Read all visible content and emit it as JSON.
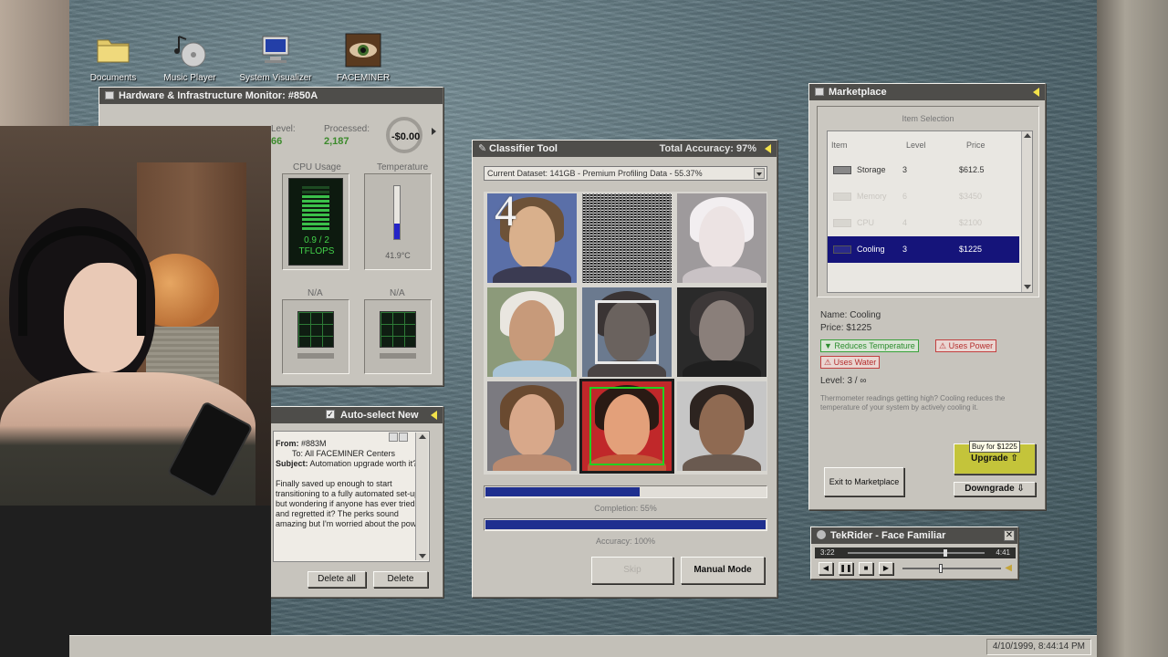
{
  "desktop_icons": [
    {
      "label": "Documents",
      "icon": "folder-icon"
    },
    {
      "label": "Music Player",
      "icon": "music-player-icon"
    },
    {
      "label": "System Visualizer",
      "icon": "monitor-icon"
    },
    {
      "label": "FACEMINER",
      "icon": "eye-icon"
    }
  ],
  "hardware": {
    "title": "Hardware & Infrastructure Monitor: #850A",
    "level_label": "Level:",
    "level_value": "66",
    "processed_label": "Processed:",
    "processed_value": "2,187",
    "money": "-$0.00",
    "cpu_label": "CPU Usage",
    "cpu_value": "0.9 / 2",
    "cpu_unit": "TFLOPS",
    "cpu_fraction": 0.45,
    "temp_label": "Temperature",
    "temp_value": "41.9°C",
    "temp_fraction": 0.3,
    "slot1_label": "N/A",
    "slot2_label": "N/A"
  },
  "classifier": {
    "title": "Classifier Tool",
    "accuracy_header": "Total Accuracy: 97%",
    "dataset": "Current Dataset: 141GB - Premium Profiling Data - 55.37%",
    "overlay_number": "4",
    "completion_label": "Completion: 55%",
    "completion_fraction": 0.55,
    "accuracy_label": "Accuracy: 100%",
    "accuracy_fraction": 1.0,
    "skip_label": "Skip",
    "manual_label": "Manual Mode"
  },
  "email": {
    "title": "Auto-select New",
    "from_label": "From:",
    "from_value": "#883M",
    "to_label": "To:",
    "to_value": "All FACEMINER Centers",
    "subject_label": "Subject:",
    "subject_value": "Automation upgrade worth it?",
    "body": "Finally saved up enough to start transitioning to a fully automated set-up, but wondering if anyone has ever tried it and regretted it? The perks sound amazing but I'm worried about the power",
    "delete_all": "Delete all",
    "delete": "Delete"
  },
  "marketplace": {
    "title": "Marketplace",
    "section": "Item Selection",
    "columns": [
      "Item",
      "Level",
      "Price"
    ],
    "items": [
      {
        "name": "Storage",
        "level": "3",
        "price": "$612.5",
        "state": "normal"
      },
      {
        "name": "Memory",
        "level": "6",
        "price": "$3450",
        "state": "disabled"
      },
      {
        "name": "CPU",
        "level": "4",
        "price": "$2100",
        "state": "disabled"
      },
      {
        "name": "Cooling",
        "level": "3",
        "price": "$1225",
        "state": "selected"
      }
    ],
    "detail_name": "Name: Cooling",
    "detail_price": "Price: $1225",
    "tags": [
      {
        "text": "▼ Reduces Temperature",
        "kind": "good"
      },
      {
        "text": "⚠ Uses Power",
        "kind": "bad"
      },
      {
        "text": "⚠ Uses Water",
        "kind": "bad"
      }
    ],
    "detail_level": "Level: 3 / ∞",
    "description": "Thermometer readings getting high? Cooling reduces the temperature of your system by actively cooling it.",
    "tooltip": "Buy for $1225",
    "upgrade": "Upgrade ⇧",
    "downgrade": "Downgrade ⇩",
    "exit": "Exit to Marketplace"
  },
  "music": {
    "title": "TekRider - Face Familiar",
    "elapsed": "3:22",
    "total": "4:41",
    "progress_fraction": 0.72,
    "volume_fraction": 0.38
  },
  "taskbar": {
    "clock": "4/10/1999, 8:44:14 PM"
  }
}
